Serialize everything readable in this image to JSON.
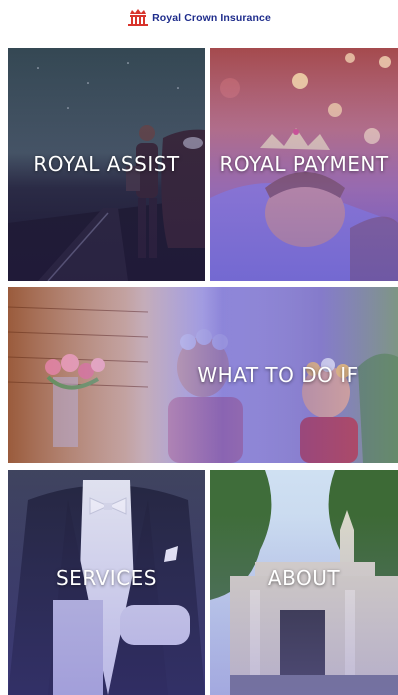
{
  "header": {
    "brand_name": "Royal Crown Insurance",
    "brand_color": "#1f2d8c",
    "logo_icon": "crown-building-icon",
    "logo_accent": "#d8342c"
  },
  "tiles": [
    {
      "id": "royal-assist",
      "label": "ROYAL ASSIST"
    },
    {
      "id": "royal-payment",
      "label": "ROYAL PAYMENT"
    },
    {
      "id": "what-to-do-if",
      "label": "WHAT TO DO IF"
    },
    {
      "id": "services",
      "label": "SERVICES"
    },
    {
      "id": "about",
      "label": "ABOUT"
    }
  ],
  "colors": {
    "overlay_violet": "#6a5fd6",
    "label_text": "#ffffff"
  }
}
